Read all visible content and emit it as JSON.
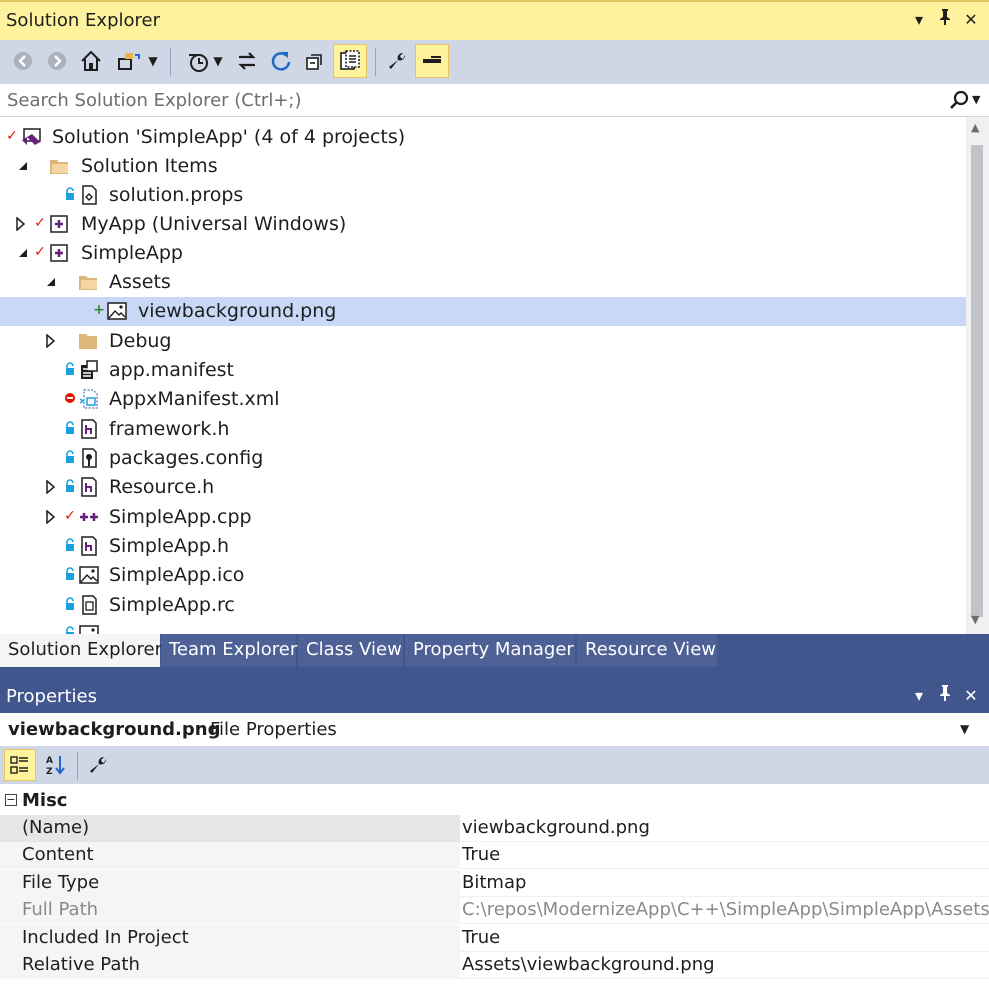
{
  "solution_explorer": {
    "title": "Solution Explorer",
    "search_placeholder": "Search Solution Explorer (Ctrl+;)",
    "tree": [
      {
        "label": "Solution 'SimpleApp' (4 of 4 projects)"
      },
      {
        "label": "Solution Items"
      },
      {
        "label": "solution.props"
      },
      {
        "label": "MyApp (Universal Windows)"
      },
      {
        "label": "SimpleApp"
      },
      {
        "label": "Assets"
      },
      {
        "label": "viewbackground.png"
      },
      {
        "label": "Debug"
      },
      {
        "label": "app.manifest"
      },
      {
        "label": "AppxManifest.xml"
      },
      {
        "label": "framework.h"
      },
      {
        "label": "packages.config"
      },
      {
        "label": "Resource.h"
      },
      {
        "label": "SimpleApp.cpp"
      },
      {
        "label": "SimpleApp.h"
      },
      {
        "label": "SimpleApp.ico"
      },
      {
        "label": "SimpleApp.rc"
      }
    ]
  },
  "tabs": [
    "Solution Explorer",
    "Team Explorer",
    "Class View",
    "Property Manager",
    "Resource View"
  ],
  "properties": {
    "title": "Properties",
    "object_name": "viewbackground.png",
    "object_type": "File Properties",
    "category": "Misc",
    "rows": [
      {
        "name": "(Name)",
        "value": "viewbackground.png"
      },
      {
        "name": "Content",
        "value": "True"
      },
      {
        "name": "File Type",
        "value": "Bitmap"
      },
      {
        "name": "Full Path",
        "value": "C:\\repos\\ModernizeApp\\C++\\SimpleApp\\SimpleApp\\Assets\\viewbackground.png"
      },
      {
        "name": "Included In Project",
        "value": "True"
      },
      {
        "name": "Relative Path",
        "value": "Assets\\viewbackground.png"
      }
    ]
  },
  "colors": {
    "active_title": "#fff29d",
    "toolbar": "#cfd6e5",
    "selection": "#c9d8f7",
    "inactive_panel": "#40568d",
    "checkmark": "#e51400",
    "lock": "#1ba1e2"
  }
}
